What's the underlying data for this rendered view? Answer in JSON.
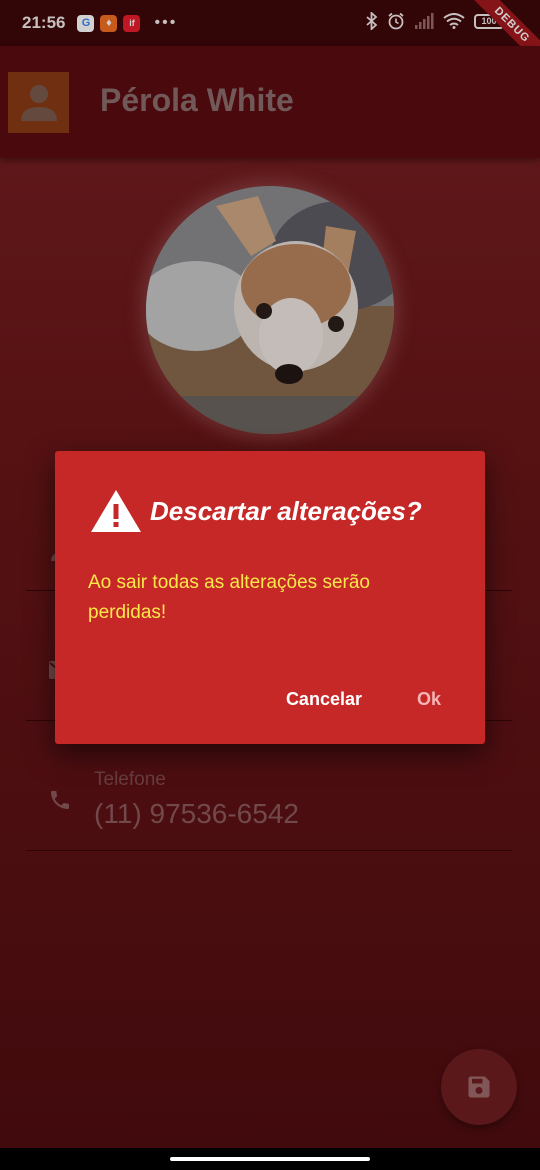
{
  "status_bar": {
    "time": "21:56",
    "apps": [
      {
        "name": "google-app-icon",
        "glyph": "G",
        "color": "#ffffff",
        "text_color": "#4285f4"
      },
      {
        "name": "orange-app-icon",
        "glyph": "♦",
        "color": "#f36f21",
        "text_color": "#ffffff"
      },
      {
        "name": "ifood-app-icon",
        "glyph": "if",
        "color": "#ea1d2c",
        "text_color": "#ffffff"
      }
    ],
    "more": "•••",
    "battery": "100",
    "debug_banner": "DEBUG"
  },
  "app_bar": {
    "title": "Pérola White"
  },
  "fields": [
    {
      "name": "name-field",
      "icon": "person-icon",
      "label": "",
      "value": ""
    },
    {
      "name": "email-field",
      "icon": "email-icon",
      "label": "",
      "value": ""
    },
    {
      "name": "phone-field",
      "icon": "phone-icon",
      "label": "Telefone",
      "value": "(11) 97536-6542"
    }
  ],
  "dialog": {
    "title": "Descartar alterações?",
    "message": "Ao sair todas as alterações serão perdidas!",
    "cancel_label": "Cancelar",
    "ok_label": "Ok",
    "icon": "warning-icon"
  },
  "fab": {
    "icon": "save-icon"
  },
  "colors": {
    "dialog_background": "#c62828",
    "dialog_message": "#fbe84a",
    "app_bar": "#5b0c0f"
  }
}
